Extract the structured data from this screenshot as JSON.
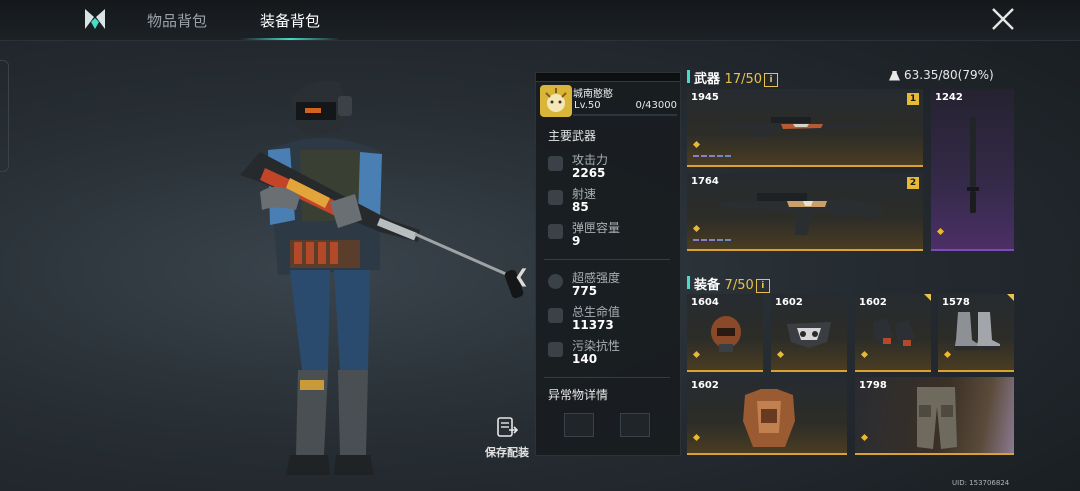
{
  "header": {
    "tabs": [
      {
        "label": "物品背包",
        "active": false
      },
      {
        "label": "装备背包",
        "active": true
      }
    ],
    "accent_color": "#46dcc8"
  },
  "player": {
    "name": "城南憨憨",
    "level": "Lv.50",
    "xp": "0/43000",
    "xp_fraction": 0
  },
  "stats_panel": {
    "primary_title": "主要武器",
    "stats": [
      {
        "label": "攻击力",
        "value": "2265",
        "icon": "attack-icon"
      },
      {
        "label": "射速",
        "value": "85",
        "icon": "fire-rate-icon"
      },
      {
        "label": "弹匣容量",
        "value": "9",
        "icon": "magazine-icon"
      },
      {
        "label": "超感强度",
        "value": "775",
        "icon": "psi-icon"
      },
      {
        "label": "总生命值",
        "value": "11373",
        "icon": "heart-icon"
      },
      {
        "label": "污染抗性",
        "value": "140",
        "icon": "biohazard-icon"
      }
    ],
    "anomaly_title": "异常物详情"
  },
  "weapons": {
    "title": "武器",
    "count": "17/50",
    "info": "i",
    "items": [
      {
        "score": "1945",
        "slot": "1"
      },
      {
        "score": "1242"
      },
      {
        "score": "1764",
        "slot": "2"
      }
    ]
  },
  "weight": "63.35/80(79%)",
  "gear": {
    "title": "装备",
    "count": "7/50",
    "info": "i",
    "items": [
      {
        "score": "1604"
      },
      {
        "score": "1602"
      },
      {
        "score": "1602"
      },
      {
        "score": "1578"
      },
      {
        "score": "1602"
      },
      {
        "score": "1798"
      }
    ]
  },
  "save_loadout_label": "保存配装",
  "uid": "UID: 153706824"
}
